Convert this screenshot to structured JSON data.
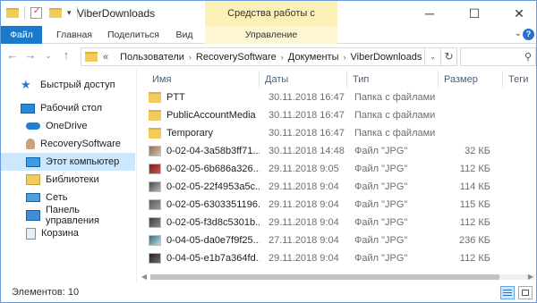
{
  "window": {
    "title": "ViberDownloads",
    "context_tab_title": "Средства работы с рисунками"
  },
  "ribbon": {
    "tabs": [
      {
        "label": "Файл"
      },
      {
        "label": "Главная"
      },
      {
        "label": "Поделиться"
      },
      {
        "label": "Вид"
      },
      {
        "label": "Управление"
      }
    ]
  },
  "address": {
    "prefix": "«",
    "crumbs": [
      "Пользователи",
      "RecoverySoftware",
      "Документы",
      "ViberDownloads"
    ]
  },
  "sidebar": {
    "items": [
      {
        "label": "Быстрый доступ",
        "icon": "star-icon"
      },
      {
        "label": "Рабочий стол",
        "icon": "desktop-icon"
      },
      {
        "label": "OneDrive",
        "icon": "cloud-icon"
      },
      {
        "label": "RecoverySoftware",
        "icon": "user-icon"
      },
      {
        "label": "Этот компьютер",
        "icon": "computer-icon"
      },
      {
        "label": "Библиотеки",
        "icon": "library-icon"
      },
      {
        "label": "Сеть",
        "icon": "network-icon"
      },
      {
        "label": "Панель управления",
        "icon": "control-panel-icon"
      },
      {
        "label": "Корзина",
        "icon": "recycle-bin-icon"
      }
    ],
    "selected_index": 4
  },
  "columns": {
    "name": "Имя",
    "date": "Даты",
    "type": "Тип",
    "size": "Размер",
    "tags": "Теги"
  },
  "files": [
    {
      "name": "PTT",
      "date": "30.11.2018 16:47",
      "type": "Папка с файлами",
      "size": "",
      "kind": "folder"
    },
    {
      "name": "PublicAccountMedia",
      "date": "30.11.2018 16:47",
      "type": "Папка с файлами",
      "size": "",
      "kind": "folder"
    },
    {
      "name": "Temporary",
      "date": "30.11.2018 16:47",
      "type": "Папка с файлами",
      "size": "",
      "kind": "folder"
    },
    {
      "name": "0-02-04-3a58b3ff71...",
      "date": "30.11.2018 14:48",
      "type": "Файл \"JPG\"",
      "size": "32 КБ",
      "kind": "image"
    },
    {
      "name": "0-02-05-6b686a326...",
      "date": "29.11.2018 9:05",
      "type": "Файл \"JPG\"",
      "size": "112 КБ",
      "kind": "image"
    },
    {
      "name": "0-02-05-22f4953a5c...",
      "date": "29.11.2018 9:04",
      "type": "Файл \"JPG\"",
      "size": "114 КБ",
      "kind": "image"
    },
    {
      "name": "0-02-05-6303351196...",
      "date": "29.11.2018 9:04",
      "type": "Файл \"JPG\"",
      "size": "115 КБ",
      "kind": "image"
    },
    {
      "name": "0-02-05-f3d8c5301b...",
      "date": "29.11.2018 9:04",
      "type": "Файл \"JPG\"",
      "size": "112 КБ",
      "kind": "image"
    },
    {
      "name": "0-04-05-da0e7f9f25...",
      "date": "27.11.2018 9:04",
      "type": "Файл \"JPG\"",
      "size": "236 КБ",
      "kind": "image"
    },
    {
      "name": "0-04-05-e1b7a364fd...",
      "date": "29.11.2018 9:04",
      "type": "Файл \"JPG\"",
      "size": "112 КБ",
      "kind": "image"
    }
  ],
  "status": {
    "text": "Элементов: 10"
  },
  "colors": {
    "accent": "#1979ca",
    "context_tab": "#fbf1b6",
    "selection": "#cce8ff",
    "folder": "#f2cc5b"
  }
}
